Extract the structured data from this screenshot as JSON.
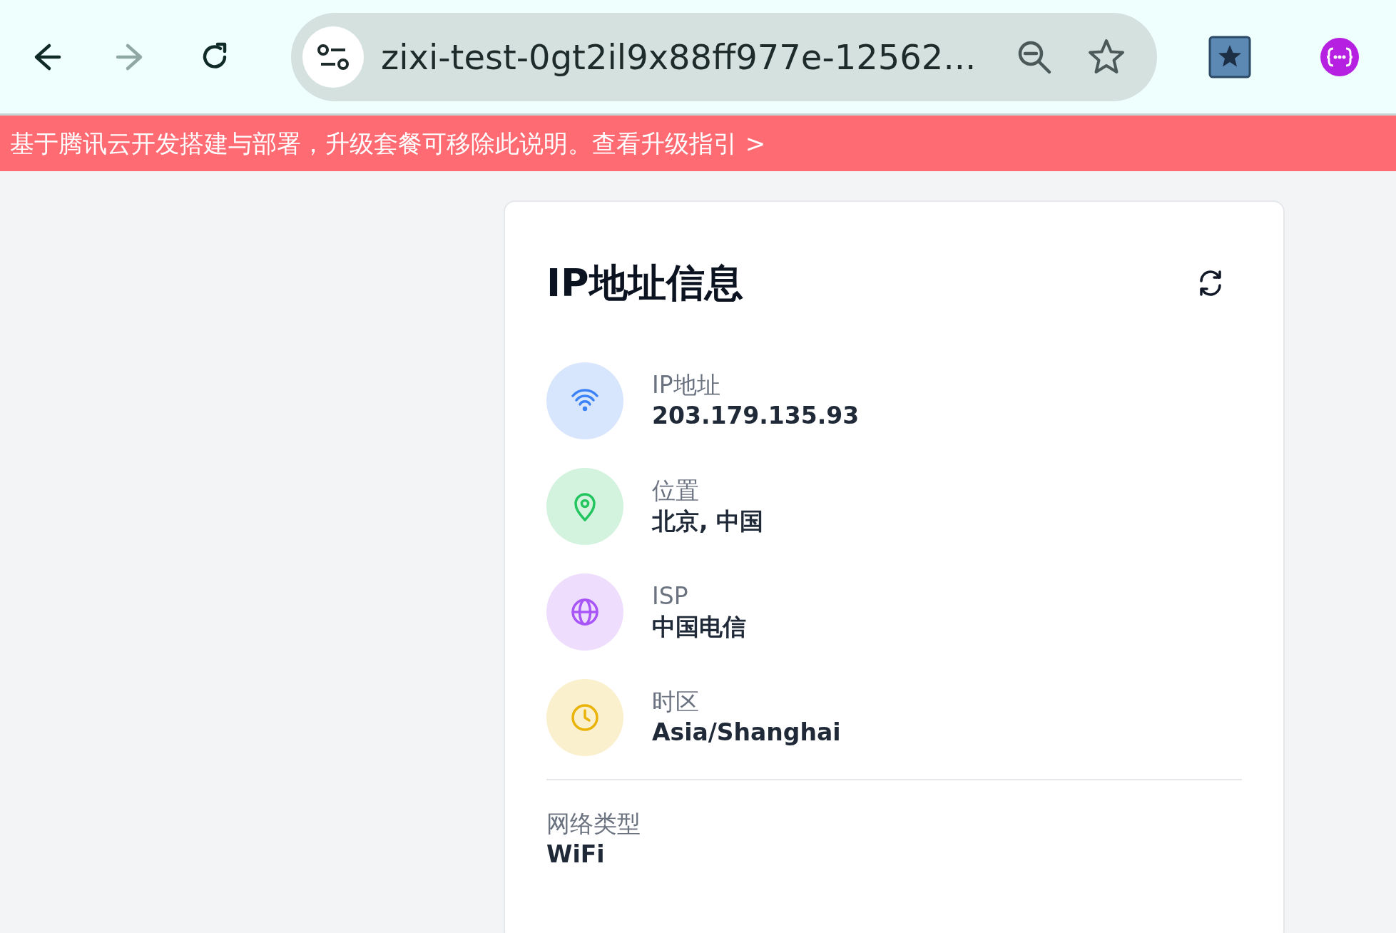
{
  "browser": {
    "nav_buttons": [
      {
        "kind": "back",
        "disabled": false
      },
      {
        "kind": "forward",
        "disabled": true
      },
      {
        "kind": "reload",
        "disabled": false
      }
    ],
    "url": "zixi-test-0gt2il9x88ff977e-12562..."
  },
  "banner": {
    "text": "基于腾讯云开发搭建与部署，升级套餐可移除此说明。查看升级指引 >"
  },
  "card": {
    "title": "IP地址信息",
    "items": [
      {
        "kind": "wifi",
        "color": "#3b82f6",
        "label": "IP地址",
        "value": "203.179.135.93"
      },
      {
        "kind": "pin",
        "color": "#22c55e",
        "label": "位置",
        "value": "北京, 中国"
      },
      {
        "kind": "globe",
        "color": "#a855f7",
        "label": "ISP",
        "value": "中国电信"
      },
      {
        "kind": "clock",
        "color": "#eab308",
        "label": "时区",
        "value": "Asia/Shanghai"
      }
    ],
    "footer": {
      "label": "网络类型",
      "value": "WiFi"
    }
  }
}
